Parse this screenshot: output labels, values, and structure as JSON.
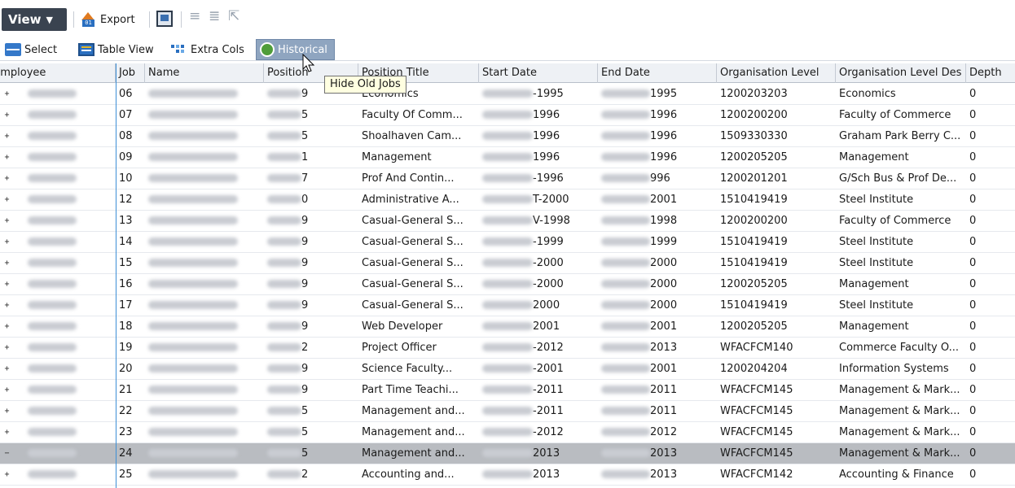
{
  "toolbar": {
    "view_label": "View",
    "export_label": "Export"
  },
  "toolbar2": {
    "select_label": "Select",
    "table_view_label": "Table View",
    "extra_cols_label": "Extra Cols",
    "historical_label": "Historical"
  },
  "tooltip": "Hide Old Jobs",
  "columns": [
    "Employee",
    "Job",
    "Name",
    "Position",
    "Position Title",
    "Start Date",
    "End Date",
    "Organisation Level",
    "Organisation Level Des",
    "Depth"
  ],
  "rows": [
    {
      "expander": "+",
      "job": "06",
      "pos_tail": "9",
      "title": "Economics",
      "start_tail": "-1995",
      "end_tail": "1995",
      "org": "1200203203",
      "org_desc": "Economics",
      "depth": "0"
    },
    {
      "expander": "+",
      "job": "07",
      "pos_tail": "5",
      "title": "Faculty Of Comm...",
      "start_tail": "1996",
      "end_tail": "1996",
      "org": "1200200200",
      "org_desc": "Faculty of Commerce",
      "depth": "0"
    },
    {
      "expander": "+",
      "job": "08",
      "pos_tail": "5",
      "title": "Shoalhaven Cam...",
      "start_tail": "1996",
      "end_tail": "1996",
      "org": "1509330330",
      "org_desc": "Graham Park Berry C...",
      "depth": "0"
    },
    {
      "expander": "+",
      "job": "09",
      "pos_tail": "1",
      "title": "Management",
      "start_tail": "1996",
      "end_tail": "1996",
      "org": "1200205205",
      "org_desc": "Management",
      "depth": "0"
    },
    {
      "expander": "+",
      "job": "10",
      "pos_tail": "7",
      "title": "Prof And Contin...",
      "start_tail": "-1996",
      "end_tail": "996",
      "org": "1200201201",
      "org_desc": "G/Sch Bus & Prof De...",
      "depth": "0"
    },
    {
      "expander": "+",
      "job": "12",
      "pos_tail": "0",
      "title": "Administrative A...",
      "start_tail": "T-2000",
      "end_tail": "2001",
      "org": "1510419419",
      "org_desc": "Steel Institute",
      "depth": "0"
    },
    {
      "expander": "+",
      "job": "13",
      "pos_tail": "9",
      "title": "Casual-General S...",
      "start_tail": "V-1998",
      "end_tail": "1998",
      "org": "1200200200",
      "org_desc": "Faculty of Commerce",
      "depth": "0"
    },
    {
      "expander": "+",
      "job": "14",
      "pos_tail": "9",
      "title": "Casual-General S...",
      "start_tail": "-1999",
      "end_tail": "1999",
      "org": "1510419419",
      "org_desc": "Steel Institute",
      "depth": "0"
    },
    {
      "expander": "+",
      "job": "15",
      "pos_tail": "9",
      "title": "Casual-General S...",
      "start_tail": "-2000",
      "end_tail": "2000",
      "org": "1510419419",
      "org_desc": "Steel Institute",
      "depth": "0"
    },
    {
      "expander": "+",
      "job": "16",
      "pos_tail": "9",
      "title": "Casual-General S...",
      "start_tail": "-2000",
      "end_tail": "2000",
      "org": "1200205205",
      "org_desc": "Management",
      "depth": "0"
    },
    {
      "expander": "+",
      "job": "17",
      "pos_tail": "9",
      "title": "Casual-General S...",
      "start_tail": "2000",
      "end_tail": "2000",
      "org": "1510419419",
      "org_desc": "Steel Institute",
      "depth": "0"
    },
    {
      "expander": "+",
      "job": "18",
      "pos_tail": "9",
      "title": "Web Developer",
      "start_tail": "2001",
      "end_tail": "2001",
      "org": "1200205205",
      "org_desc": "Management",
      "depth": "0"
    },
    {
      "expander": "+",
      "job": "19",
      "pos_tail": "2",
      "title": "Project Officer",
      "start_tail": "-2012",
      "end_tail": "2013",
      "org": "WFACFCM140",
      "org_desc": "Commerce Faculty O...",
      "depth": "0"
    },
    {
      "expander": "+",
      "job": "20",
      "pos_tail": "9",
      "title": "Science Faculty...",
      "start_tail": "-2001",
      "end_tail": "2001",
      "org": "1200204204",
      "org_desc": "Information Systems",
      "depth": "0"
    },
    {
      "expander": "+",
      "job": "21",
      "pos_tail": "9",
      "title": "Part Time Teachi...",
      "start_tail": "-2011",
      "end_tail": "2011",
      "org": "WFACFCM145",
      "org_desc": "Management & Mark...",
      "depth": "0"
    },
    {
      "expander": "+",
      "job": "22",
      "pos_tail": "5",
      "title": "Management and...",
      "start_tail": "-2011",
      "end_tail": "2011",
      "org": "WFACFCM145",
      "org_desc": "Management & Mark...",
      "depth": "0"
    },
    {
      "expander": "+",
      "job": "23",
      "pos_tail": "5",
      "title": "Management and...",
      "start_tail": "-2012",
      "end_tail": "2012",
      "org": "WFACFCM145",
      "org_desc": "Management & Mark...",
      "depth": "0"
    },
    {
      "expander": "−",
      "job": "24",
      "pos_tail": "5",
      "title": "Management and...",
      "start_tail": "2013",
      "end_tail": "2013",
      "org": "WFACFCM145",
      "org_desc": "Management & Mark...",
      "depth": "0",
      "selected": true
    },
    {
      "expander": "+",
      "job": "25",
      "pos_tail": "2",
      "title": "Accounting and...",
      "start_tail": "2013",
      "end_tail": "2013",
      "org": "WFACFCM142",
      "org_desc": "Accounting & Finance",
      "depth": "0"
    }
  ]
}
